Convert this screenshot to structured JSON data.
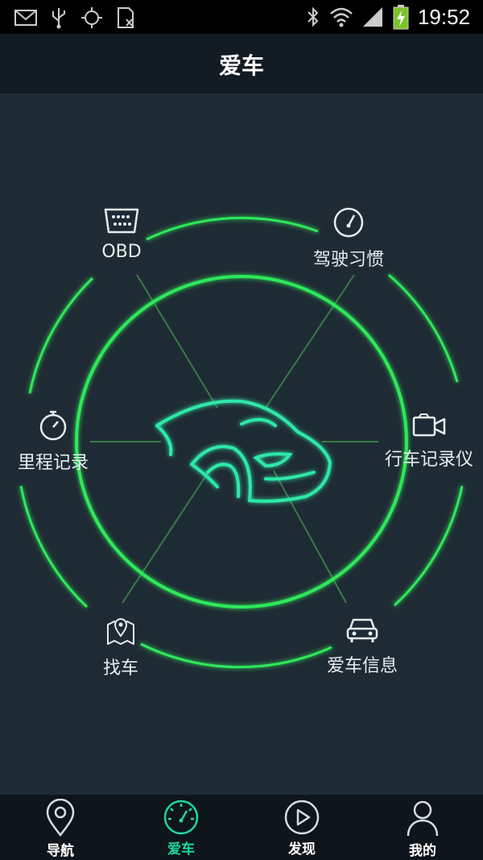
{
  "status_bar": {
    "time": "19:52",
    "left_icons": [
      "mail-icon",
      "usb-icon",
      "gps-icon",
      "sim-icon"
    ],
    "right_icons": [
      "bluetooth-icon",
      "wifi-icon",
      "signal-icon",
      "battery-charging-icon"
    ]
  },
  "header": {
    "title": "爱车"
  },
  "features": {
    "obd": {
      "label": "OBD",
      "icon": "obd-connector-icon"
    },
    "driving_habits": {
      "label": "驾驶习惯",
      "icon": "gauge-icon"
    },
    "mileage": {
      "label": "里程记录",
      "icon": "stopwatch-icon"
    },
    "dashcam": {
      "label": "行车记录仪",
      "icon": "video-camera-icon"
    },
    "find_car": {
      "label": "找车",
      "icon": "map-pin-icon"
    },
    "car_info": {
      "label": "爱车信息",
      "icon": "car-front-icon"
    }
  },
  "bottom_nav": {
    "items": [
      {
        "label": "导航",
        "icon": "location-pin-icon",
        "active": false
      },
      {
        "label": "爱车",
        "icon": "speedometer-icon",
        "active": true
      },
      {
        "label": "发现",
        "icon": "play-circle-icon",
        "active": false
      },
      {
        "label": "我的",
        "icon": "person-icon",
        "active": false
      }
    ]
  },
  "colors": {
    "accent": "#1fd89a",
    "glow": "#2ee85a",
    "background": "#1f2b34",
    "nav_background": "#0e151b"
  }
}
